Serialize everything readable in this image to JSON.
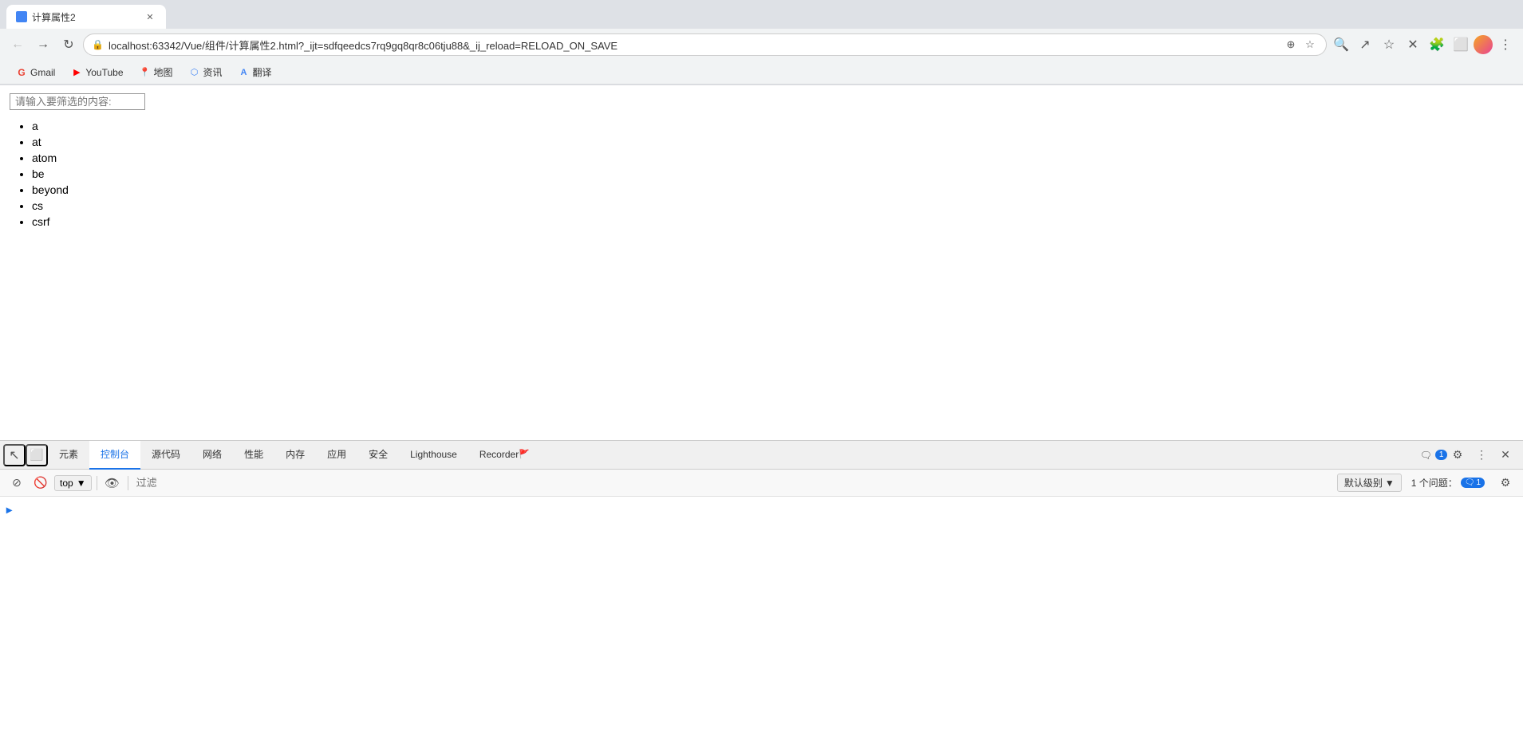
{
  "browser": {
    "tab": {
      "title": "计算属性2",
      "favicon_color": "#4285f4"
    },
    "address": "localhost:63342/Vue/组件/计算属性2.html?_ijt=sdfqeedcs7rq9gq8qr8c06tju88&_ij_reload=RELOAD_ON_SAVE",
    "bookmarks": [
      {
        "id": "gmail",
        "label": "Gmail",
        "icon": "G",
        "icon_color": "#EA4335"
      },
      {
        "id": "youtube",
        "label": "YouTube",
        "icon": "▶",
        "icon_color": "#FF0000"
      },
      {
        "id": "maps",
        "label": "地图",
        "icon": "📍",
        "icon_color": "#34A853"
      },
      {
        "id": "resource",
        "label": "资讯",
        "icon": "⬡",
        "icon_color": "#4285F4"
      },
      {
        "id": "translate",
        "label": "翻译",
        "icon": "A",
        "icon_color": "#4285F4"
      }
    ]
  },
  "page": {
    "filter_placeholder": "请输入要筛选的内容:",
    "filter_value": "",
    "items": [
      "a",
      "at",
      "atom",
      "be",
      "beyond",
      "cs",
      "csrf"
    ]
  },
  "devtools": {
    "tabs": [
      {
        "id": "elements",
        "label": "元素",
        "active": false
      },
      {
        "id": "console",
        "label": "控制台",
        "active": true
      },
      {
        "id": "sources",
        "label": "源代码",
        "active": false
      },
      {
        "id": "network",
        "label": "网络",
        "active": false
      },
      {
        "id": "performance",
        "label": "性能",
        "active": false
      },
      {
        "id": "memory",
        "label": "内存",
        "active": false
      },
      {
        "id": "application",
        "label": "应用",
        "active": false
      },
      {
        "id": "security",
        "label": "安全",
        "active": false
      },
      {
        "id": "lighthouse",
        "label": "Lighthouse",
        "active": false
      },
      {
        "id": "recorder",
        "label": "Recorder",
        "active": false
      }
    ],
    "console_badge_count": "1",
    "toolbar": {
      "context": "top",
      "filter_placeholder": "过滤",
      "default_level": "默认级别",
      "issues_label": "1 个问题：",
      "issues_count": "1"
    }
  }
}
